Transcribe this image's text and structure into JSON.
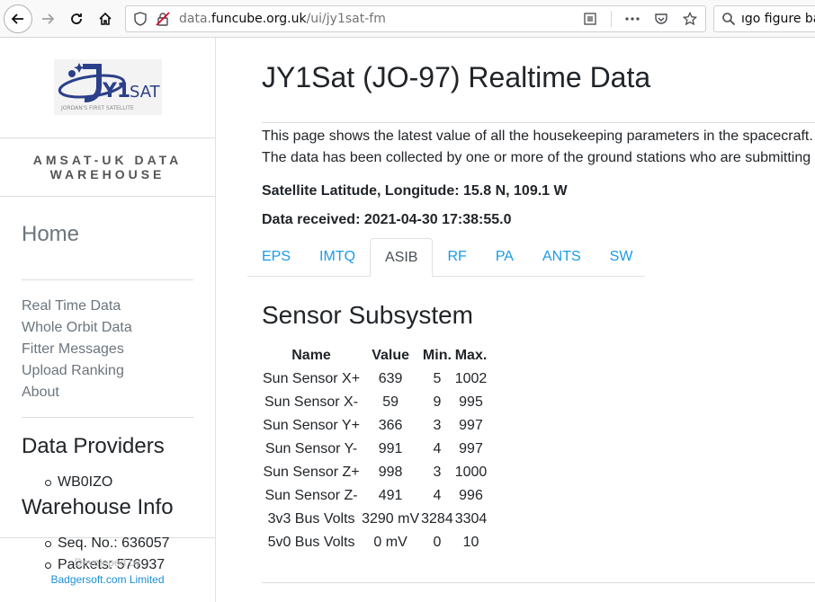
{
  "browser": {
    "url_prefix": "data.",
    "url_host": "funcube.org.uk",
    "url_path": "/ui/jy1sat-fm",
    "search_text": "ıgo figure ba"
  },
  "sidebar": {
    "logo_text": "JY1SAT",
    "logo_subtitle": "JORDAN'S FIRST SATELLITE",
    "brand_line1": "AMSAT-UK DATA",
    "brand_line2": "WAREHOUSE",
    "home": "Home",
    "nav": [
      "Real Time Data",
      "Whole Orbit Data",
      "Fitter Messages",
      "Upload Ranking",
      "About"
    ],
    "data_providers_title": "Data Providers",
    "data_providers": [
      "WB0IZO"
    ],
    "warehouse_title": "Warehouse Info",
    "warehouse_items": [
      "Seq. No.: 636057",
      "Packets: 576937"
    ],
    "developed_by": "Developed by",
    "developer": "Badgersoft.com Limited"
  },
  "main": {
    "title": "JY1Sat (JO-97) Realtime Data",
    "intro_line1": "This page shows the latest value of all the housekeeping parameters in the spacecraft.",
    "intro_line2": "The data has been collected by one or more of the ground stations who are submitting",
    "lat_lon": "Satellite Latitude, Longitude: 15.8 N, 109.1 W",
    "received": "Data received: 2021-04-30 17:38:55.0",
    "tabs": [
      "EPS",
      "IMTQ",
      "ASIB",
      "RF",
      "PA",
      "ANTS",
      "SW"
    ],
    "active_tab": "ASIB",
    "subsystem_title": "Sensor Subsystem",
    "table": {
      "headers": [
        "Name",
        "Value",
        "Min.",
        "Max."
      ],
      "rows": [
        [
          "Sun Sensor X+",
          "639",
          "5",
          "1002"
        ],
        [
          "Sun Sensor X-",
          "59",
          "9",
          "995"
        ],
        [
          "Sun Sensor Y+",
          "366",
          "3",
          "997"
        ],
        [
          "Sun Sensor Y-",
          "991",
          "4",
          "997"
        ],
        [
          "Sun Sensor Z+",
          "998",
          "3",
          "1000"
        ],
        [
          "Sun Sensor Z-",
          "491",
          "4",
          "996"
        ],
        [
          "3v3 Bus Volts",
          "3290 mV",
          "3284",
          "3304"
        ],
        [
          "5v0 Bus Volts",
          "0 mV",
          "0",
          "10"
        ]
      ]
    }
  },
  "colors": {
    "link": "#1a9be6",
    "muted": "#6c757d",
    "text": "#212529"
  }
}
